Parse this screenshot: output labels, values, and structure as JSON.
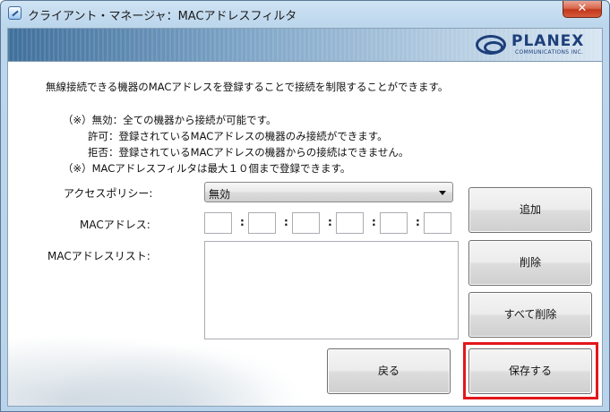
{
  "window": {
    "title": "クライアント・マネージャ：MACアドレスフィルタ",
    "close_label": "✕"
  },
  "logo": {
    "name": "PLANEX",
    "tagline": "COMMUNICATIONS INC."
  },
  "intro": "無線接続できる機器のMACアドレスを登録することで接続を制限することができます。",
  "notes": [
    "（※）無効：全ての機器から接続が可能です。",
    "許可：登録されているMACアドレスの機器のみ接続ができます。",
    "拒否：登録されているMACアドレスの機器からの接続はできません。",
    "（※）MACアドレスフィルタは最大１０個まで登録できます。"
  ],
  "form": {
    "policy_label": "アクセスポリシー:",
    "policy_value": "無効",
    "mac_label": "MACアドレス:",
    "mac_separator": ":",
    "mac_octets": [
      "",
      "",
      "",
      "",
      "",
      ""
    ],
    "list_label": "MACアドレスリスト:",
    "list_items": []
  },
  "buttons": {
    "add": "追加",
    "delete": "削除",
    "delete_all": "すべて削除",
    "back": "戻る",
    "save": "保存する"
  },
  "colors": {
    "highlight": "#e3161b",
    "accent": "#1d3f7a"
  }
}
